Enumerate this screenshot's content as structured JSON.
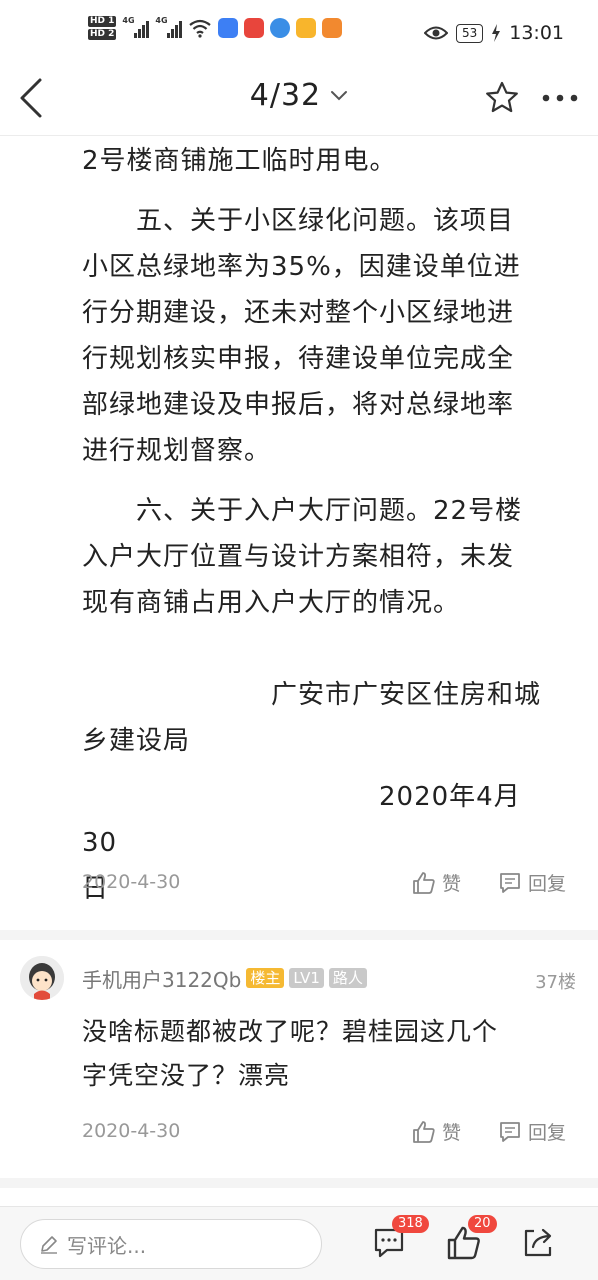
{
  "status_bar": {
    "hd1": "HD 1",
    "hd2": "HD 2",
    "net1": "4G",
    "net2": "4G",
    "battery": "53",
    "time": "13:01",
    "app_icon_colors": [
      "#3d7ff4",
      "#e8453c",
      "#3a8ee6",
      "#f8b52c",
      "#f2892f"
    ]
  },
  "nav": {
    "page_indicator": "4/32",
    "back_icon": "chevron-left-icon",
    "favorite_icon": "star-icon",
    "more_icon": "more-dots-icon"
  },
  "article": {
    "lines": [
      "2号楼商铺施工临时用电。",
      "　　五、关于小区绿化问题。该项目",
      "小区总绿地率为35%，因建设单位进",
      "行分期建设，还未对整个小区绿地进",
      "行规划核实申报，待建设单位完成全",
      "部绿地建设及申报后，将对总绿地率",
      "进行规划督察。",
      "　　六、关于入户大厅问题。22号楼",
      "入户大厅位置与设计方案相符，未发",
      "现有商铺占用入户大厅的情况。",
      "　　　　　　　广安市广安区住房和城",
      "乡建设局",
      "　　　　　　　　　　　2020年4月30",
      "日"
    ],
    "date": "2020-4-30",
    "like_label": "赞",
    "reply_label": "回复"
  },
  "comment": {
    "username": "手机用户3122Qb",
    "badge_owner": "楼主",
    "badge_level": "LV1",
    "badge_role": "路人",
    "floor": "37楼",
    "lines": [
      "没啥标题都被改了呢？碧桂园这几个",
      "字凭空没了？漂亮"
    ],
    "date": "2020-4-30",
    "like_label": "赞",
    "reply_label": "回复"
  },
  "bottom_bar": {
    "comment_placeholder": "写评论...",
    "comment_count": "318",
    "like_count": "20"
  }
}
